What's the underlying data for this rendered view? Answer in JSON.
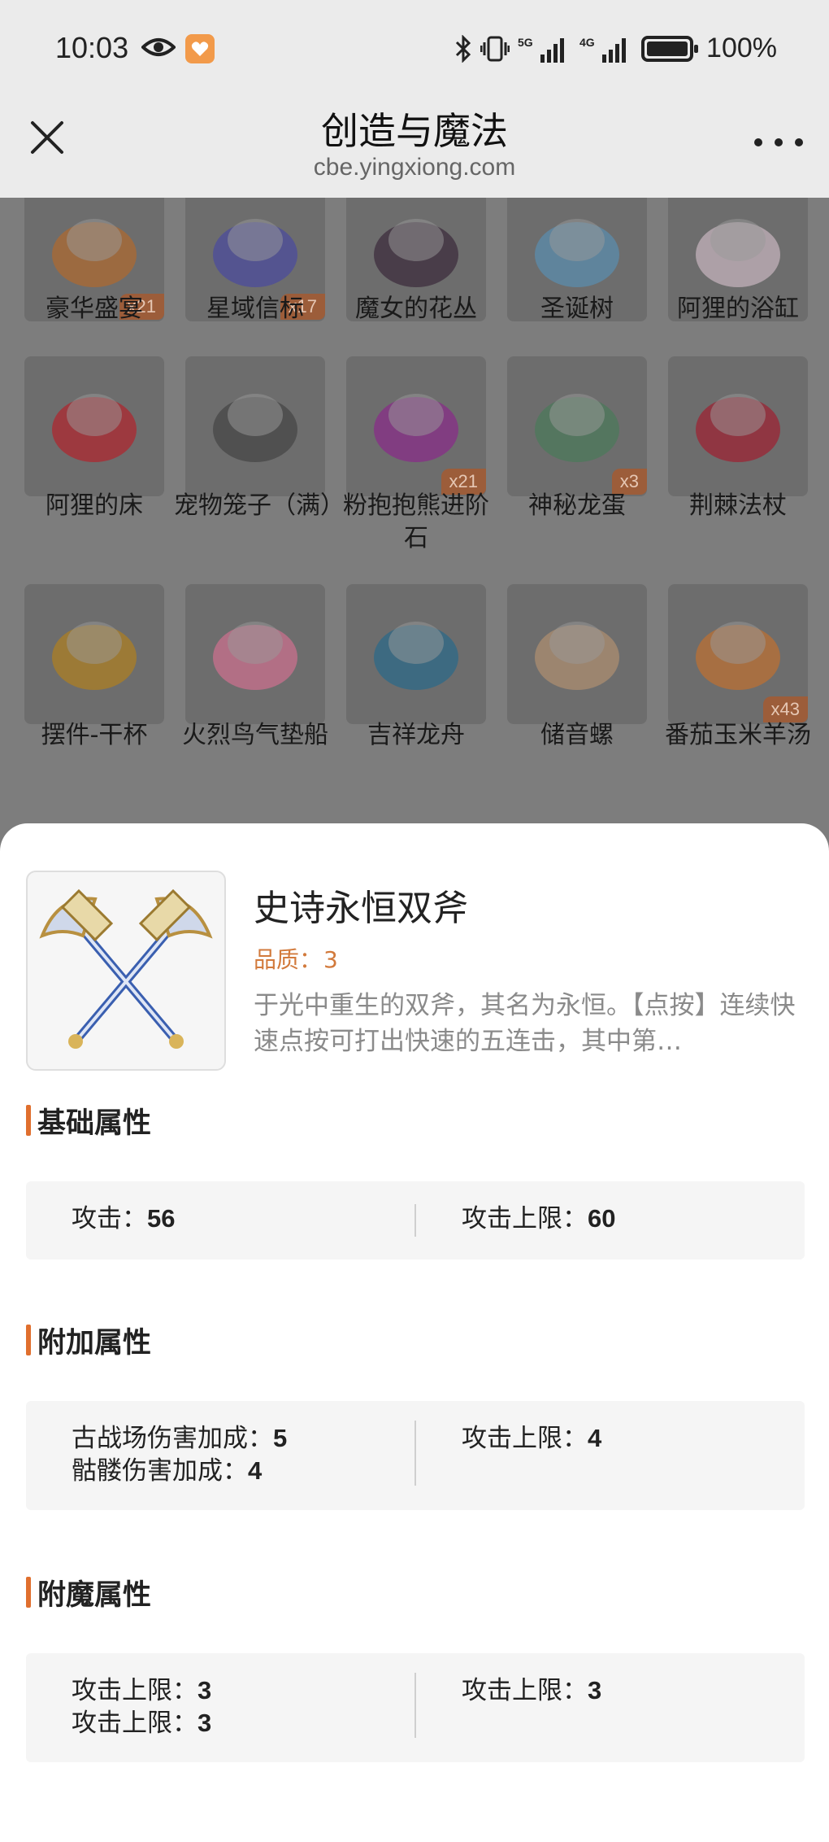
{
  "status": {
    "time": "10:03",
    "network_1": "5G",
    "network_2": "4G",
    "battery": "100%",
    "battery_level": 1.0
  },
  "header": {
    "title": "创造与魔法",
    "url": "cbe.yingxiong.com"
  },
  "grid": {
    "items": [
      {
        "label": "豪华盛宴",
        "count": "x21",
        "icon": "feast-bowl-icon",
        "color": "#b06a2e"
      },
      {
        "label": "星域信标",
        "count": "x17",
        "icon": "star-beacon-icon",
        "color": "#4a4aa0"
      },
      {
        "label": "魔女的花丛",
        "count": "",
        "icon": "witch-flowers-icon",
        "color": "#3a2a3a"
      },
      {
        "label": "圣诞树",
        "count": "",
        "icon": "christmas-tree-icon",
        "color": "#5a8fb0"
      },
      {
        "label": "阿狸的浴缸",
        "count": "",
        "icon": "bathtub-icon",
        "color": "#c9b6c0"
      },
      {
        "label": "阿狸的床",
        "count": "",
        "icon": "bed-icon",
        "color": "#b2242c"
      },
      {
        "label": "宠物笼子（满）",
        "count": "",
        "icon": "pet-cage-icon",
        "color": "#444444"
      },
      {
        "label": "粉抱抱熊进阶石",
        "count": "x21",
        "icon": "gem-stone-icon",
        "color": "#8a2a8a"
      },
      {
        "label": "神秘龙蛋",
        "count": "x3",
        "icon": "dragon-egg-icon",
        "color": "#4a7a5a"
      },
      {
        "label": "荆棘法杖",
        "count": "",
        "icon": "thorn-staff-icon",
        "color": "#a02030"
      },
      {
        "label": "摆件-干杯",
        "count": "",
        "icon": "cheers-ornament-icon",
        "color": "#b08020"
      },
      {
        "label": "火烈鸟气垫船",
        "count": "",
        "icon": "flamingo-float-icon",
        "color": "#d07090"
      },
      {
        "label": "吉祥龙舟",
        "count": "",
        "icon": "dragon-boat-icon",
        "color": "#2a6a8a"
      },
      {
        "label": "储音螺",
        "count": "",
        "icon": "conch-icon",
        "color": "#b09070"
      },
      {
        "label": "番茄玉米羊汤",
        "count": "x43",
        "icon": "soup-bowl-icon",
        "color": "#c07030"
      }
    ]
  },
  "detail": {
    "name": "史诗永恒双斧",
    "quality_label": "品质：",
    "quality_value": "3",
    "description": "于光中重生的双斧，其名为永恒。【点按】连续快速点按可打出快速的五连击，其中第…",
    "icon": "twin-axes-icon",
    "sections": [
      {
        "title": "基础属性",
        "left": [
          {
            "label": "攻击：",
            "value": "56"
          }
        ],
        "right": [
          {
            "label": "攻击上限：",
            "value": "60"
          }
        ]
      },
      {
        "title": "附加属性",
        "left": [
          {
            "label": "古战场伤害加成：",
            "value": "5"
          },
          {
            "label": "骷髅伤害加成：",
            "value": "4"
          }
        ],
        "right": [
          {
            "label": "攻击上限：",
            "value": "4"
          }
        ]
      },
      {
        "title": "附魔属性",
        "left": [
          {
            "label": "攻击上限：",
            "value": "3"
          },
          {
            "label": "攻击上限：",
            "value": "3"
          }
        ],
        "right": [
          {
            "label": "攻击上限：",
            "value": "3"
          }
        ]
      }
    ]
  },
  "colors": {
    "accent": "#e06f2e",
    "quality": "#d27a3c",
    "overlay": "#7d7d7d"
  }
}
